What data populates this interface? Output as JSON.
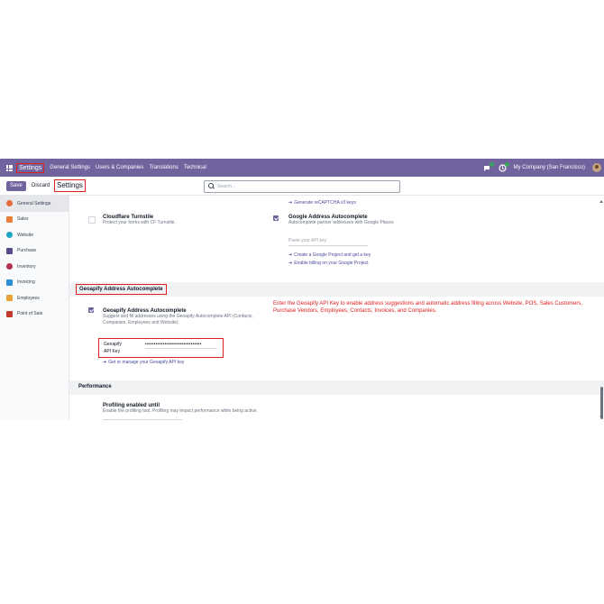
{
  "navbar": {
    "brand": "Settings",
    "menu": [
      "General Settings",
      "Users & Companies",
      "Translations",
      "Technical"
    ],
    "company": "My Company (San Francisco)"
  },
  "control": {
    "save_label": "Save",
    "discard_label": "Discard",
    "breadcrumb": "Settings",
    "search_placeholder": "Search..."
  },
  "sidebar": {
    "items": [
      {
        "label": "General Settings",
        "color": "#e36b3c"
      },
      {
        "label": "Sales",
        "color": "#e8803a"
      },
      {
        "label": "Website",
        "color": "#1ea7c4"
      },
      {
        "label": "Purchase",
        "color": "#5b4a8a"
      },
      {
        "label": "Inventory",
        "color": "#b03050"
      },
      {
        "label": "Invoicing",
        "color": "#2c8fd6"
      },
      {
        "label": "Employees",
        "color": "#e8a23a"
      },
      {
        "label": "Point of Sale",
        "color": "#c0392b"
      }
    ]
  },
  "main": {
    "recaptcha_link": "Generate reCAPTCHA v3 keys",
    "cloudflare": {
      "title": "Cloudflare Turnstile",
      "desc": "Protect your forms with CF Turnstile."
    },
    "google": {
      "title": "Google Address Autocomplete",
      "desc": "Autocomplete partner addresses with Google Places",
      "placeholder": "Paste your API key",
      "link1": "Create a Google Project and get a key",
      "link2": "Enable billing on your Google Project"
    },
    "geo_section": "Geoapify Address Autocomplete",
    "annotation": "Enter the Geoapify API Key to enable address suggestions and automatic address filling across Website, POS, Sales Customers, Purchase Vendors, Employees, Contacts, Invoices, and Companies.",
    "geo": {
      "title": "Geoapify Address Autocomplete",
      "desc": "Suggest and fill addresses using the Geoapify Autocomplete API (Contacts, Companies, Employees and Website).",
      "label_line1": "Geoapify",
      "label_line2": "API Key",
      "value": "••••••••••••••••••••••••••••••••",
      "link": "Get or manage your Geoapify API key"
    },
    "perf_section": "Performance",
    "profiling": {
      "title": "Profiling enabled until",
      "desc": "Enable the profiling tool. Profiling may impact performance while being active."
    }
  }
}
